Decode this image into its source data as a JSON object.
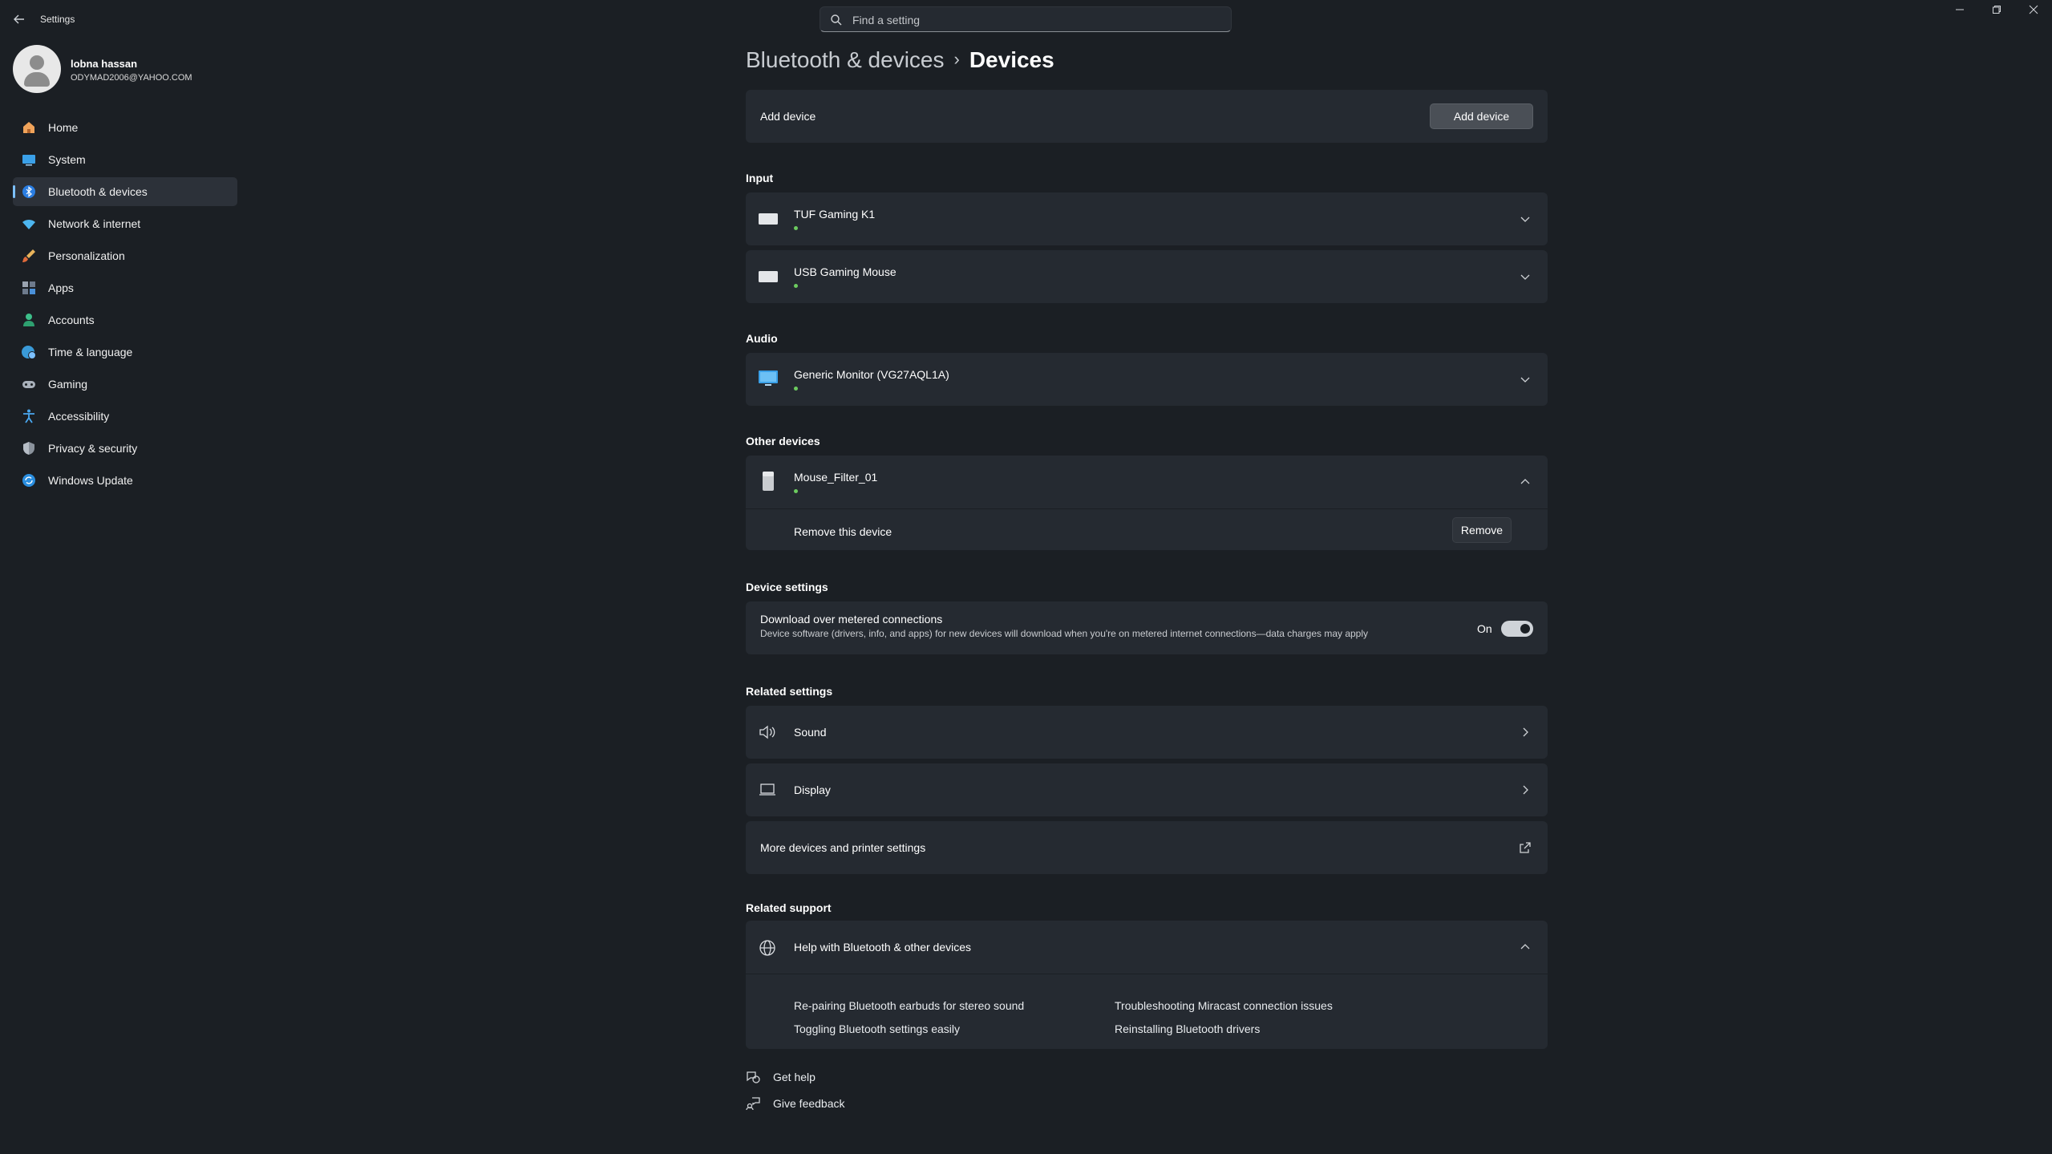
{
  "window": {
    "title": "Settings",
    "back_icon": "back-arrow-icon",
    "controls": [
      "minimize-icon",
      "restore-icon",
      "close-icon"
    ]
  },
  "search": {
    "placeholder": "Find a setting",
    "icon": "search-icon"
  },
  "user": {
    "name": "lobna hassan",
    "email": "ODYMAD2006@YAHOO.COM"
  },
  "nav": [
    {
      "label": "Home",
      "icon": "home-icon",
      "active": false
    },
    {
      "label": "System",
      "icon": "system-icon",
      "active": false
    },
    {
      "label": "Bluetooth & devices",
      "icon": "bluetooth-icon",
      "active": true
    },
    {
      "label": "Network & internet",
      "icon": "wifi-icon",
      "active": false
    },
    {
      "label": "Personalization",
      "icon": "brush-icon",
      "active": false
    },
    {
      "label": "Apps",
      "icon": "apps-icon",
      "active": false
    },
    {
      "label": "Accounts",
      "icon": "accounts-icon",
      "active": false
    },
    {
      "label": "Time & language",
      "icon": "globe-clock-icon",
      "active": false
    },
    {
      "label": "Gaming",
      "icon": "gamepad-icon",
      "active": false
    },
    {
      "label": "Accessibility",
      "icon": "accessibility-icon",
      "active": false
    },
    {
      "label": "Privacy & security",
      "icon": "shield-icon",
      "active": false
    },
    {
      "label": "Windows Update",
      "icon": "update-icon",
      "active": false
    }
  ],
  "breadcrumb": {
    "parent": "Bluetooth & devices",
    "separator": "›",
    "current": "Devices"
  },
  "add_device": {
    "label": "Add device",
    "button": "Add device"
  },
  "input": {
    "heading": "Input",
    "devices": [
      {
        "name": "TUF Gaming K1",
        "icon": "keyboard-icon"
      },
      {
        "name": "USB Gaming Mouse",
        "icon": "keyboard-icon"
      }
    ]
  },
  "audio": {
    "heading": "Audio",
    "devices": [
      {
        "name": "Generic Monitor (VG27AQL1A)",
        "icon": "monitor-icon"
      }
    ]
  },
  "other_devices": {
    "heading": "Other devices",
    "device": {
      "name": "Mouse_Filter_01",
      "icon": "device-icon"
    },
    "remove_label": "Remove this device",
    "remove_button": "Remove"
  },
  "device_settings": {
    "heading": "Device settings",
    "metered_title": "Download over metered connections",
    "metered_desc": "Device software (drivers, info, and apps) for new devices will download when you're on metered internet connections—data charges may apply",
    "toggle_state": "On",
    "toggle_on": true
  },
  "related_settings": {
    "heading": "Related settings",
    "items": [
      {
        "label": "Sound",
        "icon": "speaker-icon"
      },
      {
        "label": "Display",
        "icon": "laptop-icon"
      },
      {
        "label": "More devices and printer settings",
        "icon": "external-link-icon"
      }
    ]
  },
  "related_support": {
    "heading": "Related support",
    "title": "Help with Bluetooth & other devices",
    "icon": "globe-icon",
    "links": [
      "Re-pairing Bluetooth earbuds for stereo sound",
      "Troubleshooting Miracast connection issues",
      "Toggling Bluetooth settings easily",
      "Reinstalling Bluetooth drivers"
    ]
  },
  "footer": {
    "get_help": "Get help",
    "give_feedback": "Give feedback"
  },
  "colors": {
    "background": "#1b1f24",
    "card": "#252a31",
    "accent": "#7cc0ff",
    "status_dot": "#6ccb5f"
  }
}
